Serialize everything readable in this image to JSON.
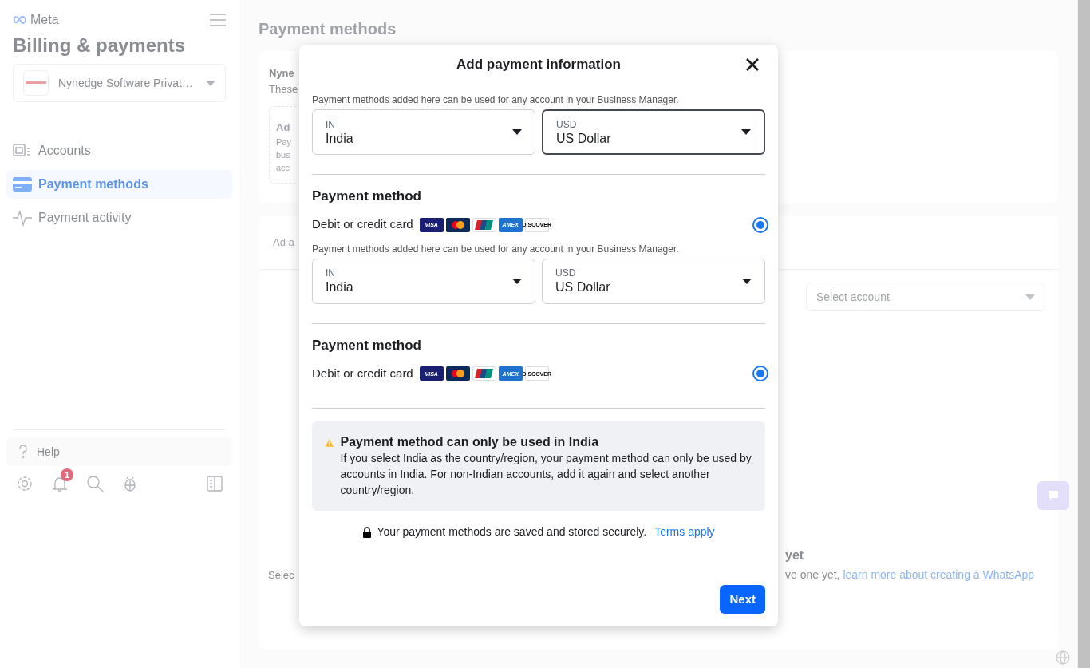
{
  "sidebar": {
    "logo": "Meta",
    "title": "Billing & payments",
    "business": {
      "name": "Nynedge Software Privat…"
    },
    "nav": [
      {
        "label": "Accounts",
        "selected": false
      },
      {
        "label": "Payment methods",
        "selected": true
      },
      {
        "label": "Payment activity",
        "selected": false
      }
    ],
    "help": "Help",
    "notification_count": "1"
  },
  "main": {
    "title": "Payment methods",
    "card1": {
      "heading": "Nyne",
      "subtext": "These",
      "inner": {
        "heading": "Ad",
        "lines": [
          "Pay",
          "bus",
          "acc"
        ]
      }
    },
    "card2": {
      "tab": "Ad a",
      "select": {
        "placeholder": "Select account"
      },
      "empty_heading": "yet",
      "left_text": "Selec",
      "right_text": "ve one yet, ",
      "right_link": "learn more about creating a WhatsApp"
    }
  },
  "modal": {
    "title": "Add payment information",
    "sections": [
      {
        "description": "Payment methods added here can be used for any account in your Business Manager.",
        "selects": [
          {
            "code": "IN",
            "value": "India",
            "focused": false
          },
          {
            "code": "USD",
            "value": "US Dollar",
            "focused": true
          }
        ],
        "heading": "Payment method",
        "method": {
          "label": "Debit or credit card",
          "selected": true
        },
        "cards": [
          {
            "kind": "visa",
            "text": "VISA"
          },
          {
            "kind": "mastercard"
          },
          {
            "kind": "unionpay"
          },
          {
            "kind": "amex",
            "text": "AMEX"
          },
          {
            "kind": "discover",
            "text": "DISCOVER"
          }
        ]
      },
      {
        "description": "Payment methods added here can be used for any account in your Business Manager.",
        "selects": [
          {
            "code": "IN",
            "value": "India",
            "focused": false
          },
          {
            "code": "USD",
            "value": "US Dollar",
            "focused": false
          }
        ],
        "heading": "Payment method",
        "method": {
          "label": "Debit or credit card",
          "selected": true
        },
        "cards": [
          {
            "kind": "visa",
            "text": "VISA"
          },
          {
            "kind": "mastercard"
          },
          {
            "kind": "unionpay"
          },
          {
            "kind": "amex",
            "text": "AMEX"
          },
          {
            "kind": "discover",
            "text": "DISCOVER"
          }
        ]
      }
    ],
    "notice": {
      "title": "Payment method can only be used in India",
      "body": "If you select India as the country/region, your payment method can only be used by accounts in India. For non-Indian accounts, add it again and select another country/region."
    },
    "secure_note": {
      "text": "Your payment methods are saved and stored securely.",
      "link": "Terms apply"
    },
    "next": "Next"
  }
}
